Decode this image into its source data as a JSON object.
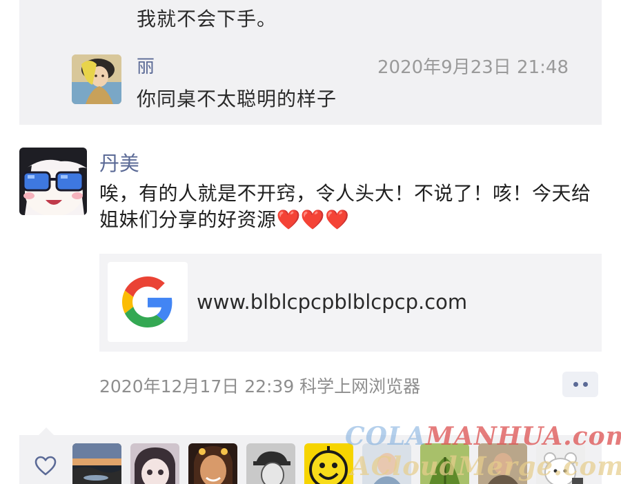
{
  "comments": {
    "previous_text": "我就不会下手。",
    "items": [
      {
        "author": "丽",
        "time": "2020年9月23日 21:48",
        "text": "你同桌不太聪明的样子",
        "avatar": "illustrated-girl-avatar"
      }
    ]
  },
  "post": {
    "author": "丹美",
    "avatar": "cartoon-girl-sunglasses-avatar",
    "text": "唉，有的人就是不开窍，令人头大！不说了！咳！今天给姐妹们分享的好资源❤️❤️❤️",
    "link": {
      "icon": "google-logo-icon",
      "url": "www.blblcpcpblblcpcp.com"
    },
    "meta": "2020年12月17日 22:39 科学上网浏览器",
    "more_icon": "more-dots-icon"
  },
  "likes": {
    "icon": "heart-outline-icon",
    "avatar_count_visible": 9
  },
  "watermark": {
    "line1_a": "COLA",
    "line1_b": "MANHUA.com",
    "line2": "ACloudMerge.com"
  },
  "colors": {
    "name_link": "#5b6a96",
    "panel_bg": "#f1f1f3",
    "meta_text": "#8e8e8e",
    "google_blue": "#4285F4",
    "google_red": "#EA4335",
    "google_yellow": "#FBBC05",
    "google_green": "#34A853"
  }
}
